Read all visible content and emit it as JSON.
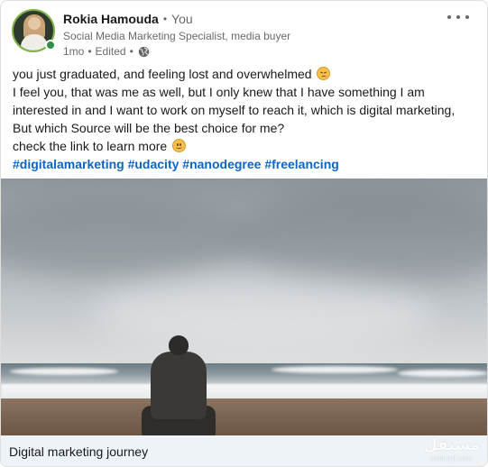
{
  "post": {
    "author": {
      "name": "Rokia Hamouda",
      "relation": "You",
      "headline": "Social Media Marketing Specialist, media buyer",
      "time_ago": "1mo",
      "edited_label": "Edited",
      "visibility_icon": "globe-icon",
      "online_status": "online"
    },
    "menu_icon": "more-options-icon",
    "text_lines": [
      "you just graduated, and feeling lost and overwhelmed",
      "I feel you, that was me as well, but I only knew that I have something I am",
      "interested in and I want to work on myself to reach it, which is digital marketing,",
      "But which Source will be the best choice for me?",
      "check the link to learn more"
    ],
    "emojis": {
      "line1": "disappointed-face-emoji",
      "line5": "smiling-face-emoji"
    },
    "hashtags": [
      "#digitalamarketing",
      "#udacity",
      "#nanodegree",
      "#freelancing"
    ],
    "link_preview": {
      "caption": "Digital marketing journey"
    }
  },
  "watermark": {
    "arabic": "مستقل",
    "latin": "mostaql.com"
  },
  "colors": {
    "link_blue": "#0a66c2",
    "caption_bg": "#eef3f8",
    "online_green": "#2f8e4a"
  }
}
